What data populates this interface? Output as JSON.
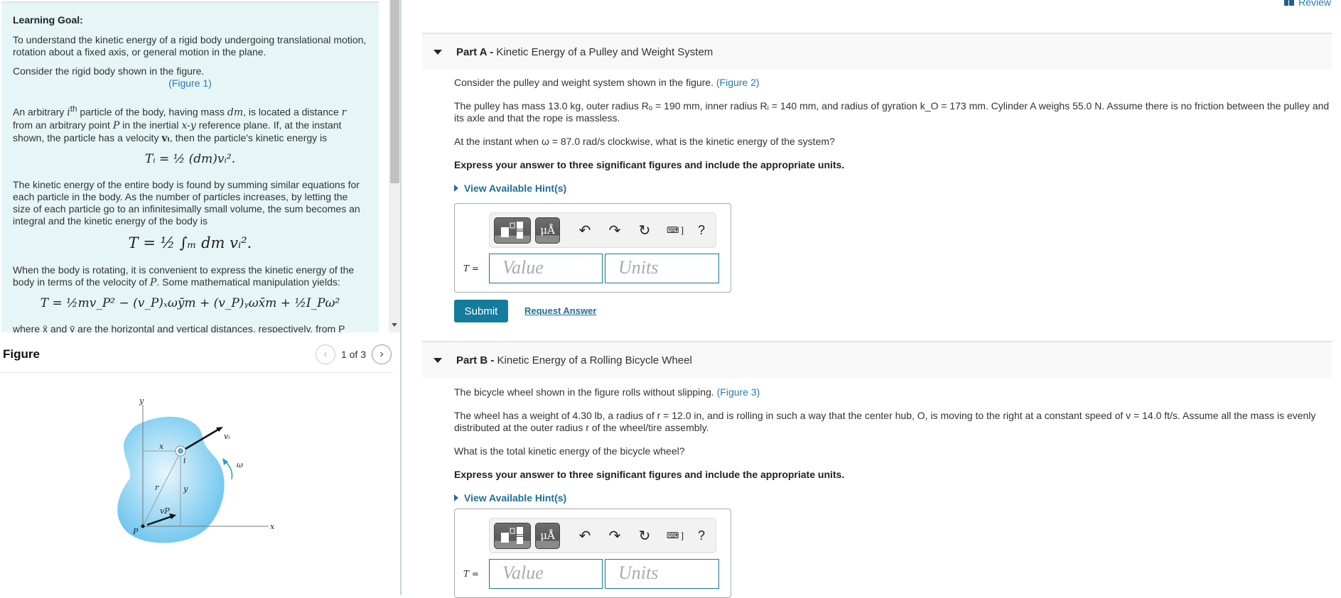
{
  "learning_goal": {
    "title": "Learning Goal:",
    "intro": "To understand the kinetic energy of a rigid body undergoing translational motion, rotation about a fixed axis, or general motion in the plane.",
    "consider": "Consider the rigid body shown in the figure.",
    "figure_link": "(Figure 1)",
    "para1_a": "An arbitrary ",
    "para1_ith": "i",
    "para1_th": "th",
    "para1_b": " particle of the body, having mass ",
    "para1_dm": "dm",
    "para1_c": ", is located a distance ",
    "para1_r": "r",
    "para1_d": " from an arbitrary point ",
    "para1_P": "P",
    "para1_e": " in the inertial ",
    "para1_xy": "x-y",
    "para1_f": " reference plane. If, at the instant shown, the particle has a velocity ",
    "para1_vi": "vᵢ",
    "para1_g": ", then the particle's kinetic energy is",
    "eq1": "Tᵢ = ½ (dm)vᵢ².",
    "para2": "The kinetic energy of the entire body is found by summing similar equations for each particle in the body. As the number of particles increases, by letting the size of each particle go to an infinitesimally small volume, the sum becomes an integral and the kinetic energy of the body is",
    "eq2": "T = ½ ∫ₘ dm vᵢ².",
    "para3_a": "When the body is rotating, it is convenient to express the kinetic energy of the body in terms of the velocity of ",
    "para3_P": "P",
    "para3_b": ". Some mathematical manipulation yields:",
    "eq3": "T = ½mv_P² − (v_P)ₓωȳm + (v_P)ᵧωx̄m + ½I_Pω²",
    "para4": "where x̄ and ȳ are the horizontal and vertical distances, respectively, from P"
  },
  "figure_panel": {
    "title": "Figure",
    "pager": "1 of 3",
    "labels": {
      "y_axis": "y",
      "x_axis": "x",
      "x_dist": "x",
      "y_dist": "y",
      "r": "r",
      "vi": "vᵢ",
      "i": "i",
      "omega": "ω",
      "vP": "vP",
      "P": "P"
    }
  },
  "header": {
    "review": "Review"
  },
  "parts": [
    {
      "label": "Part A -",
      "title": "Kinetic Energy of a Pulley and Weight System",
      "p1_text": "Consider the pulley and weight system shown in the figure. ",
      "p1_link": "(Figure 2)",
      "p2": "The pulley has mass 13.0 kg, outer radius Rₒ = 190 mm, inner radius Rᵢ = 140 mm, and radius of gyration k_O = 173 mm. Cylinder A weighs 55.0 N. Assume there is no friction between the pulley and its axle and that the rope is massless.",
      "p3": "At the instant when ω = 87.0 rad/s clockwise, what is the kinetic energy of the system?",
      "instruction": "Express your answer to three significant figures and include the appropriate units.",
      "hint": "View Available Hint(s)",
      "var": "T =",
      "value_placeholder": "Value",
      "units_placeholder": "Units",
      "submit": "Submit",
      "request": "Request Answer"
    },
    {
      "label": "Part B -",
      "title": "Kinetic Energy of a Rolling Bicycle Wheel",
      "p1_text": "The bicycle wheel shown in the figure rolls without slipping. ",
      "p1_link": "(Figure 3)",
      "p2": "The wheel has a weight of 4.30 lb, a radius of r = 12.0 in, and is rolling in such a way that the center hub, O, is moving to the right at a constant speed of v = 14.0 ft/s. Assume all the mass is evenly distributed at the outer radius r of the wheel/tire assembly.",
      "p3": "What is the total kinetic energy of the bicycle wheel?",
      "instruction": "Express your answer to three significant figures and include the appropriate units.",
      "hint": "View Available Hint(s)",
      "var": "T =",
      "value_placeholder": "Value",
      "units_placeholder": "Units"
    }
  ],
  "toolbar": {
    "units_label": "μÅ",
    "undo": "↶",
    "redo": "↷",
    "reset": "↻",
    "keyboard": "⌨ ]",
    "help": "?"
  }
}
